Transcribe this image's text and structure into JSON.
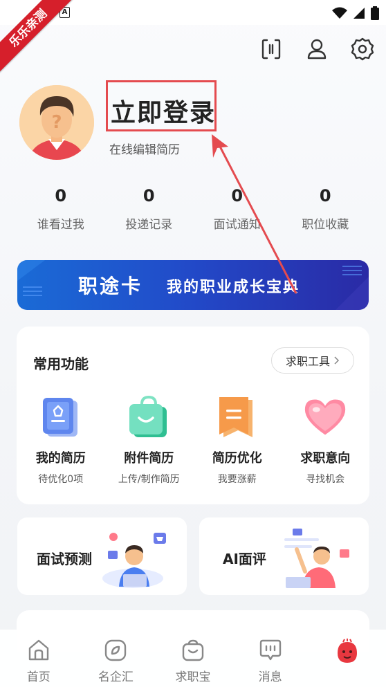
{
  "status_bar": {
    "app_badge": "A"
  },
  "corner_ribbon": "乐乐亲测",
  "header": {
    "login_title": "立即登录",
    "subtitle": "在线编辑简历"
  },
  "stats": [
    {
      "value": "0",
      "label": "谁看过我"
    },
    {
      "value": "0",
      "label": "投递记录"
    },
    {
      "value": "0",
      "label": "面试通知"
    },
    {
      "value": "0",
      "label": "职位收藏"
    }
  ],
  "career_banner": {
    "title": "职途卡",
    "slogan": "我的职业成长宝典"
  },
  "functions": {
    "title": "常用功能",
    "tools_button": "求职工具",
    "items": [
      {
        "label": "我的简历",
        "sub": "待优化0项",
        "icon": "resume-icon"
      },
      {
        "label": "附件简历",
        "sub": "上传/制作简历",
        "icon": "attachment-bag-icon"
      },
      {
        "label": "简历优化",
        "sub": "我要涨薪",
        "icon": "optimize-bookmark-icon"
      },
      {
        "label": "求职意向",
        "sub": "寻找机会",
        "icon": "heart-icon"
      }
    ]
  },
  "cards": {
    "interview_predict": "面试预测",
    "ai_review": "AI面评"
  },
  "bottom_nav": [
    {
      "label": "首页",
      "icon": "home-icon"
    },
    {
      "label": "名企汇",
      "icon": "compass-icon"
    },
    {
      "label": "求职宝",
      "icon": "bag-icon"
    },
    {
      "label": "消息",
      "icon": "message-icon"
    },
    {
      "label": "",
      "icon": "mascot-icon"
    }
  ],
  "colors": {
    "accent_red": "#e44b4f",
    "banner_blue": "#2249c8",
    "ribbon_red": "#d61f2b"
  }
}
